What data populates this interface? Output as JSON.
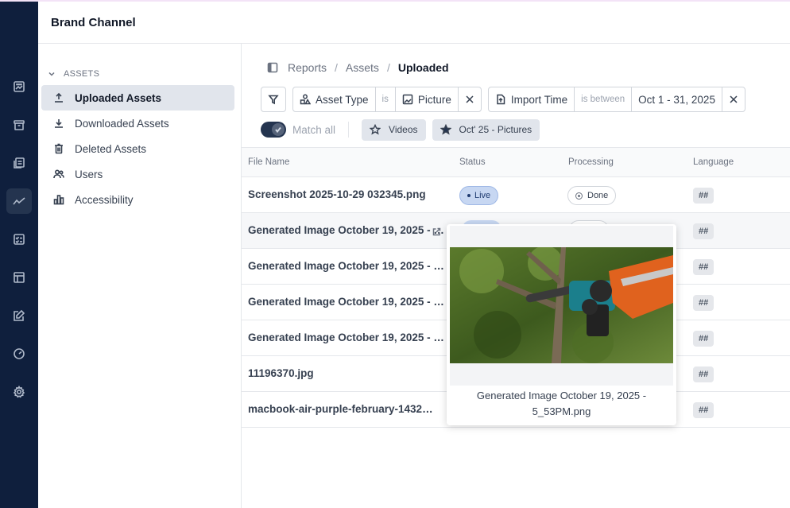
{
  "app": {
    "title": "Brand Channel"
  },
  "rail_icons": [
    "image-icon",
    "archive-icon",
    "documents-icon",
    "trend-icon",
    "checklist-icon",
    "layout-icon",
    "edit-icon",
    "gauge-icon",
    "gear-icon"
  ],
  "sidebar": {
    "section_label": "ASSETS",
    "items": [
      {
        "label": "Uploaded Assets",
        "icon": "upload-icon",
        "active": true
      },
      {
        "label": "Downloaded Assets",
        "icon": "download-icon",
        "active": false
      },
      {
        "label": "Deleted Assets",
        "icon": "trash-icon",
        "active": false
      },
      {
        "label": "Users",
        "icon": "users-icon",
        "active": false
      },
      {
        "label": "Accessibility",
        "icon": "bar-chart-icon",
        "active": false
      }
    ]
  },
  "breadcrumb": {
    "items": [
      "Reports",
      "Assets"
    ],
    "current": "Uploaded",
    "separator": "/"
  },
  "filters": {
    "asset_type": {
      "field": "Asset Type",
      "operator": "is",
      "value": "Picture"
    },
    "import_time": {
      "field": "Import Time",
      "operator": "is between",
      "value": "Oct 1 - 31, 2025"
    },
    "match_all_label": "Match all",
    "match_all": true,
    "saved": [
      "Videos",
      "Oct' 25 - Pictures"
    ]
  },
  "table": {
    "columns": [
      "File Name",
      "Status",
      "Processing",
      "Language"
    ],
    "rows": [
      {
        "file": "Screenshot 2025-10-29 032345.png",
        "status": "Live",
        "processing": "Done",
        "language": "##"
      },
      {
        "file": "Generated Image October 19, 2025 - …",
        "language": "##"
      },
      {
        "file": "Generated Image October 19, 2025 - …",
        "language": "##"
      },
      {
        "file": "Generated Image October 19, 2025 - …",
        "language": "##"
      },
      {
        "file": "Generated Image October 19, 2025 - …",
        "language": "##"
      },
      {
        "file": "11196370.jpg",
        "language": "##"
      },
      {
        "file": "macbook-air-purple-february-1432…",
        "language": "##"
      }
    ]
  },
  "preview": {
    "caption": "Generated Image October 19, 2025 - 5_53PM.png"
  },
  "colors": {
    "rail": "#0f1f3d",
    "active_nav": "#e1e5ec",
    "live_badge": "#c7d7f2"
  }
}
